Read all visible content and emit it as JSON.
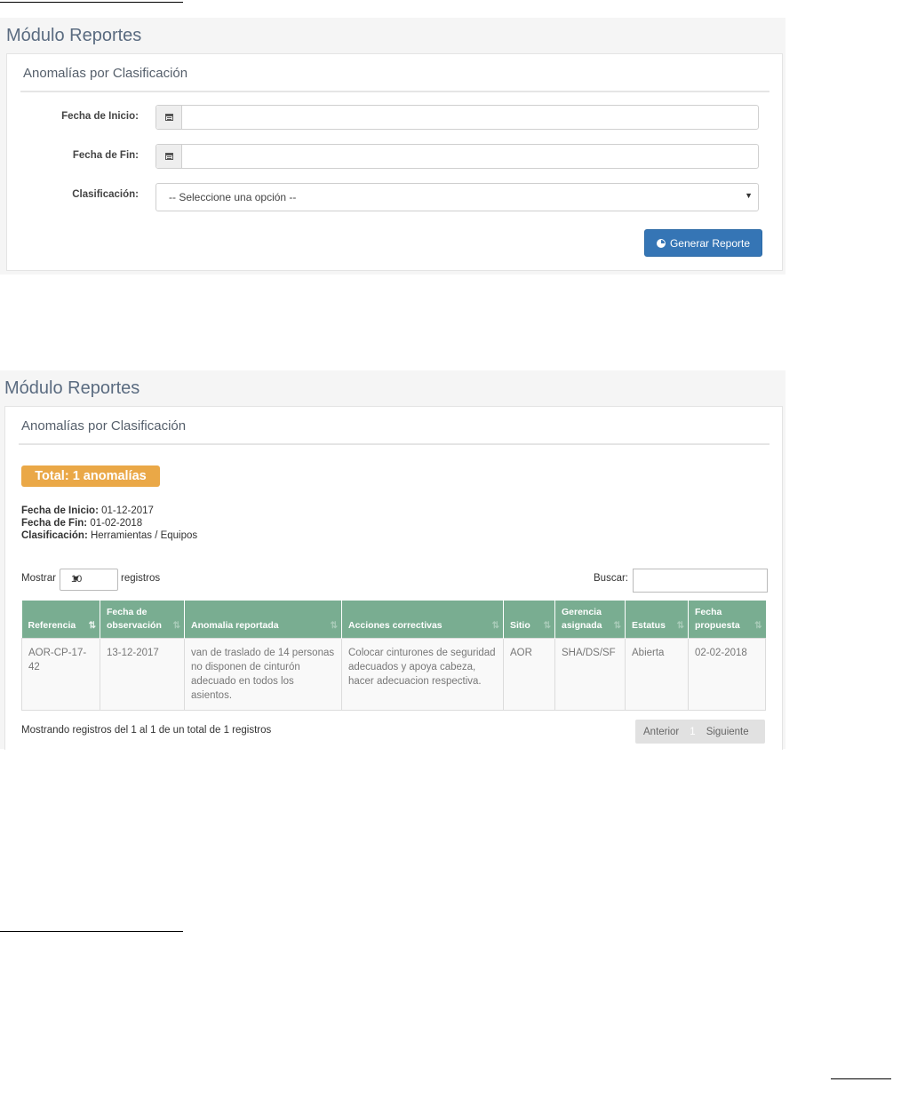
{
  "panel1": {
    "module_title": "Módulo Reportes",
    "card_title": "Anomalías por Clasificación",
    "form": {
      "start_label": "Fecha de Inicio:",
      "start_value": "",
      "end_label": "Fecha de Fin:",
      "end_value": "",
      "class_label": "Clasificación:",
      "class_selected": "-- Seleccione una opción --"
    },
    "generate_button": "Generar Reporte"
  },
  "panel2": {
    "module_title": "Módulo Reportes",
    "card_title": "Anomalías por Clasificación",
    "total_badge": "Total: 1 anomalías",
    "summary": {
      "start_label": "Fecha de Inicio:",
      "start_value": "01-12-2017",
      "end_label": "Fecha de Fin:",
      "end_value": "01-02-2018",
      "class_label": "Clasificación:",
      "class_value": "Herramientas / Equipos"
    },
    "length_label": "Mostrar",
    "length_value": "10",
    "length_suffix": "registros",
    "search_label": "Buscar:",
    "search_value": "",
    "columns": [
      "Referencia",
      "Fecha de observación",
      "Anomalia reportada",
      "Acciones correctivas",
      "Sitio",
      "Gerencia asignada",
      "Estatus",
      "Fecha propuesta"
    ],
    "rows": [
      [
        "AOR-CP-17-42",
        "13-12-2017",
        "van de traslado de 14 personas no disponen de cinturón adecuado en todos los asientos.",
        "Colocar cinturones de seguridad adecuados y apoya cabeza, hacer adecuacion respectiva.",
        "AOR",
        "SHA/DS/SF",
        "Abierta",
        "02-02-2018"
      ]
    ],
    "footer_info": "Mostrando registros del 1 al 1 de un total de 1 registros",
    "pager": {
      "prev": "Anterior",
      "page": "1",
      "next": "Siguiente"
    }
  },
  "icons": [
    "calendar-icon",
    "pie-chart-icon",
    "sort-icon",
    "caret-down-icon"
  ],
  "colors": {
    "primary": "#3575b5",
    "badge": "#eaa847",
    "table_header": "#79ad91"
  }
}
